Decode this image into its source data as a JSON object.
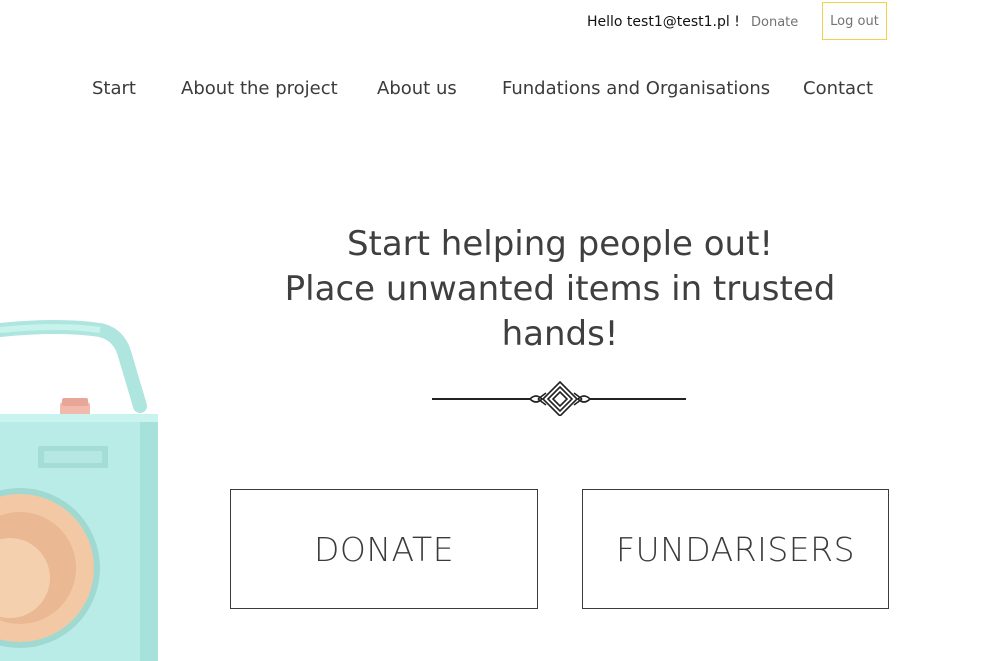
{
  "user_bar": {
    "greeting": "Hello test1@test1.pl !",
    "donate_label": "Donate",
    "logout_label": "Log out"
  },
  "nav": {
    "items": [
      {
        "label": "Start"
      },
      {
        "label": "About the project"
      },
      {
        "label": "About us"
      },
      {
        "label": "Fundations and Organisations"
      },
      {
        "label": "Contact"
      }
    ]
  },
  "hero": {
    "title_lines": [
      "Start helping people out!",
      "Place unwanted items in trusted",
      "hands!"
    ],
    "donate_button": "DONATE",
    "fundraisers_button": "FUNDARISERS"
  },
  "icons": {
    "decoration": "ornament-divider-icon",
    "illustration": "radio-illustration"
  },
  "colors": {
    "logout_border": "#f2d24a",
    "radio_body": "#b9ece6",
    "speaker": "#f0c8a3",
    "text": "#3b3b3b"
  }
}
